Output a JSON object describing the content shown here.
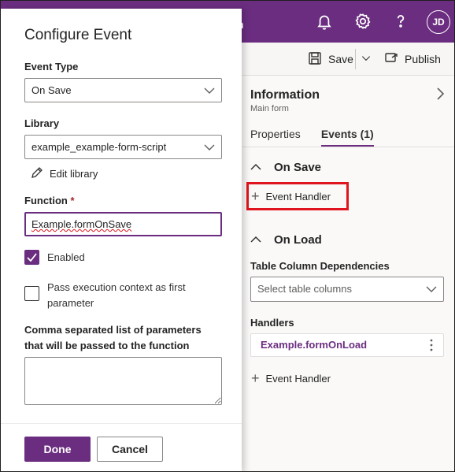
{
  "topbar": {
    "title_fragment": "n",
    "avatar_initials": "JD",
    "icons": [
      "bell-icon",
      "gear-icon",
      "help-icon"
    ]
  },
  "commandbar": {
    "save_label": "Save",
    "publish_label": "Publish"
  },
  "properties_panel": {
    "title": "Information",
    "subtitle": "Main form",
    "tabs": [
      {
        "label": "Properties",
        "active": false
      },
      {
        "label": "Events (1)",
        "active": true
      }
    ],
    "on_save": {
      "heading": "On Save",
      "event_handler_label": "Event Handler"
    },
    "on_load": {
      "heading": "On Load",
      "dependencies_label": "Table Column Dependencies",
      "dependencies_placeholder": "Select table columns",
      "handlers_label": "Handlers",
      "handlers": [
        "Example.formOnLoad"
      ],
      "event_handler_label": "Event Handler"
    }
  },
  "dialog": {
    "title": "Configure Event",
    "event_type_label": "Event Type",
    "event_type_value": "On Save",
    "library_label": "Library",
    "library_value": "example_example-form-script",
    "edit_library_label": "Edit library",
    "function_label": "Function",
    "function_required_mark": "*",
    "function_value": "Example.formOnSave",
    "enabled_label": "Enabled",
    "enabled_checked": true,
    "pass_context_label": "Pass execution context as first parameter",
    "pass_context_checked": false,
    "params_label": "Comma separated list of parameters that will be passed to the function",
    "params_value": "",
    "done_label": "Done",
    "cancel_label": "Cancel"
  },
  "colors": {
    "brand": "#6b2d80",
    "highlight": "#e0141e"
  }
}
